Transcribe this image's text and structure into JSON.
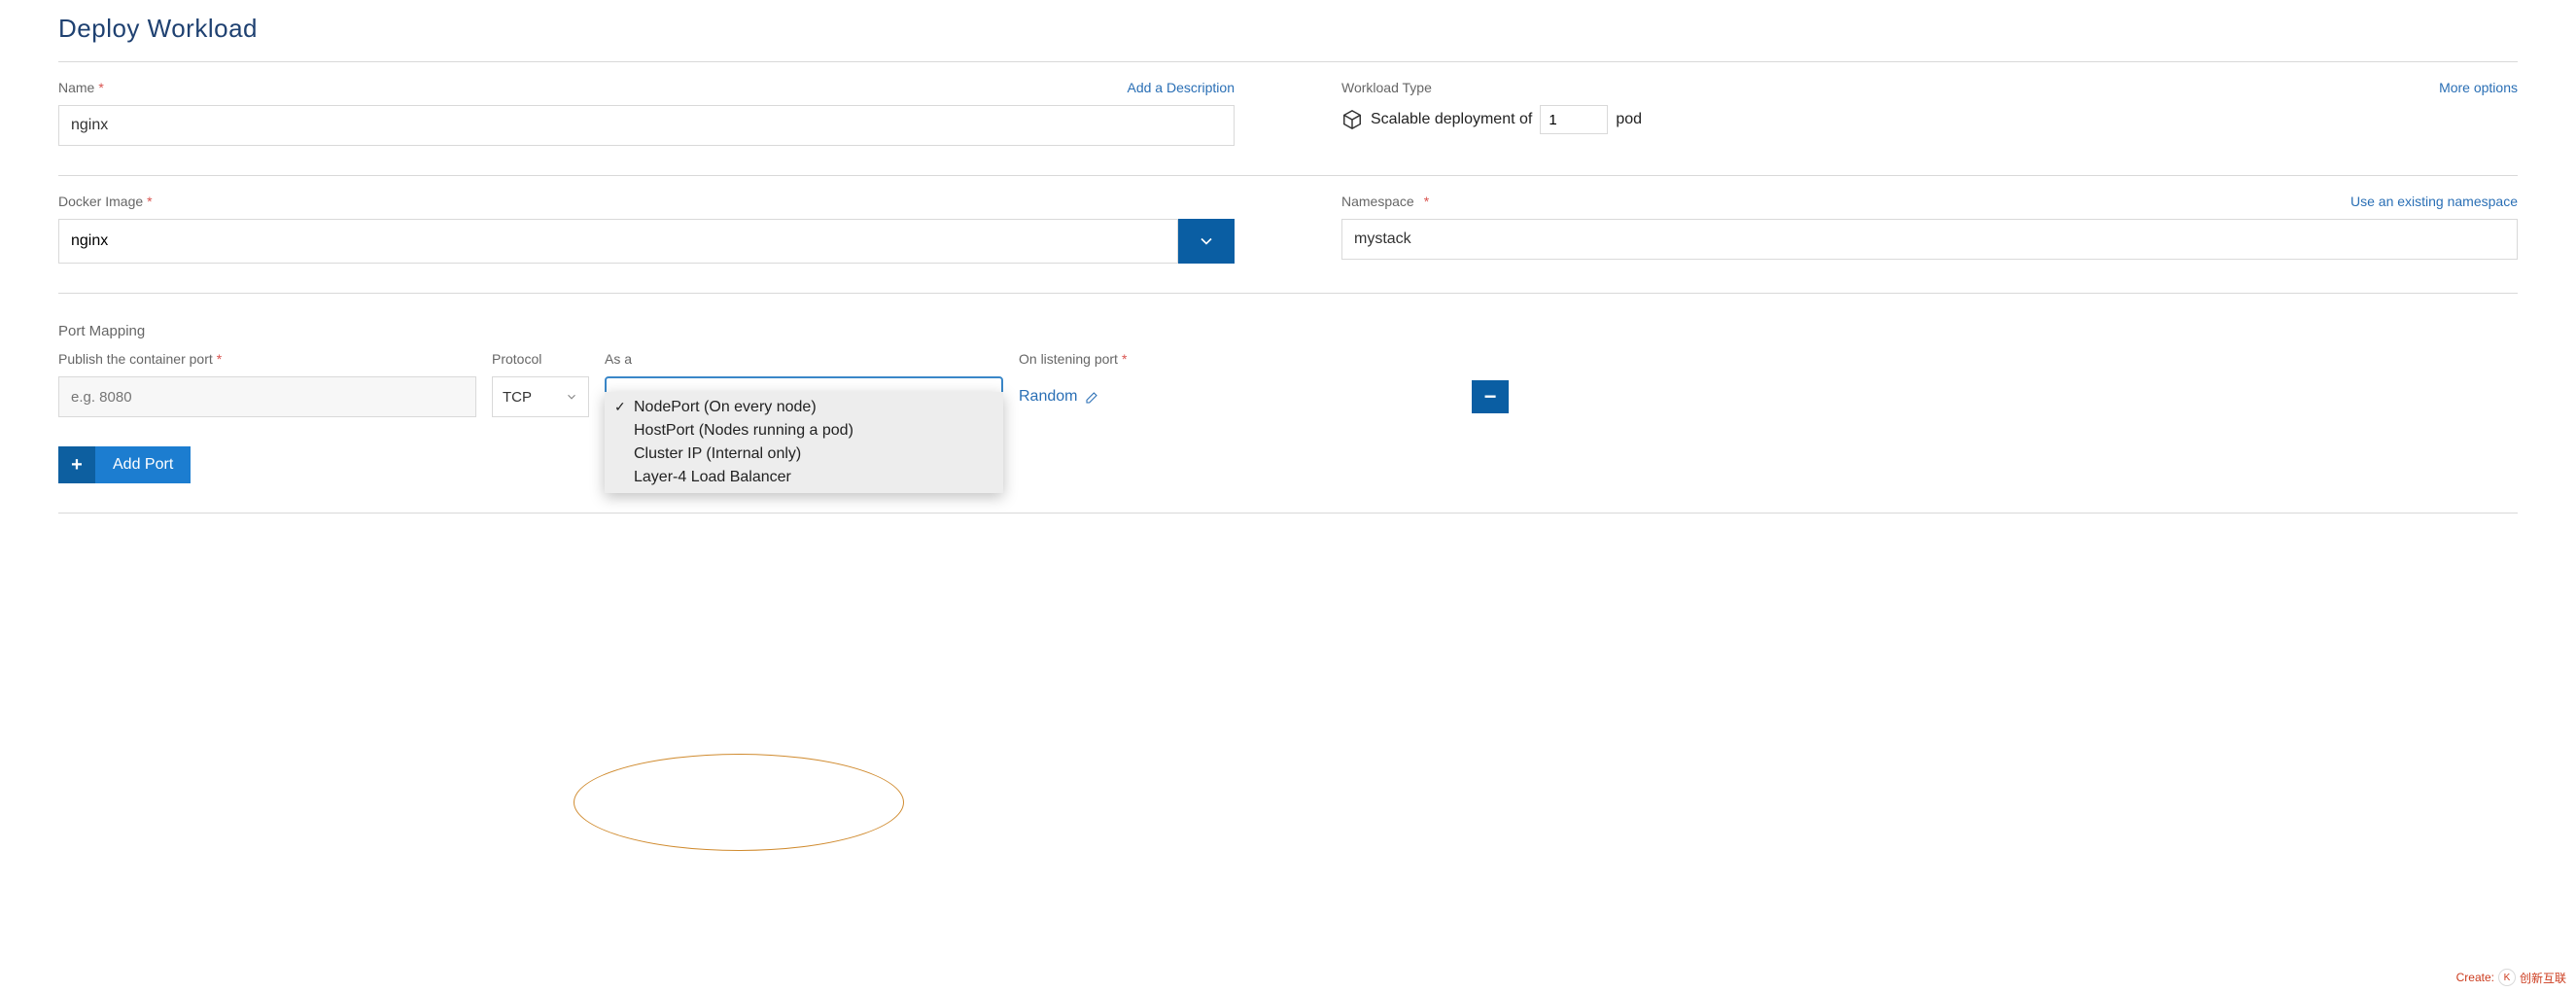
{
  "pageTitle": "Deploy Workload",
  "name": {
    "label": "Name",
    "value": "nginx",
    "addDescription": "Add a Description"
  },
  "workloadType": {
    "label": "Workload Type",
    "moreOptions": "More options",
    "prefix": "Scalable deployment of",
    "pods": "1",
    "suffix": "pod"
  },
  "dockerImage": {
    "label": "Docker Image",
    "value": "nginx"
  },
  "namespace": {
    "label": "Namespace",
    "value": "mystack",
    "useExisting": "Use an existing namespace"
  },
  "portMapping": {
    "sectionLabel": "Port Mapping",
    "publishLabel": "Publish the container port",
    "publishPlaceholder": "e.g. 8080",
    "protocolLabel": "Protocol",
    "protocolValue": "TCP",
    "asALabel": "As a",
    "asAOptions": [
      "NodePort (On every node)",
      "HostPort (Nodes running a pod)",
      "Cluster IP (Internal only)",
      "Layer-4 Load Balancer"
    ],
    "asASelectedIndex": 0,
    "onListeningLabel": "On listening port",
    "onListeningValue": "Random",
    "addPort": "Add Port"
  },
  "watermark": {
    "create": "Create:",
    "brand": "创新互联"
  }
}
